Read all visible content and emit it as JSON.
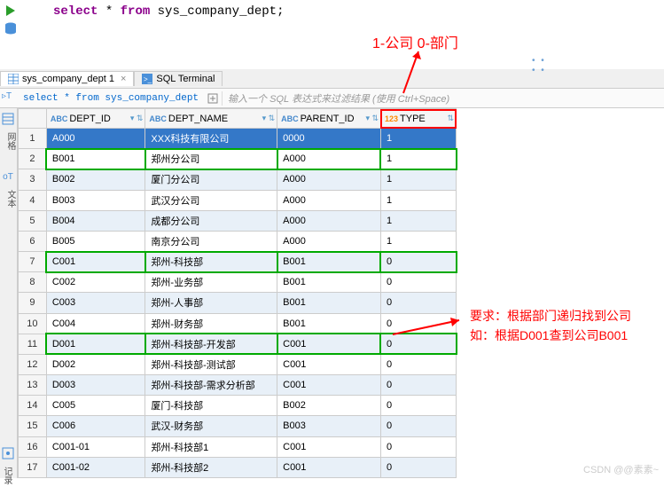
{
  "sql": {
    "keyword_select": "select",
    "star": " * ",
    "keyword_from": "from",
    "table": " sys_company_dept;"
  },
  "annotations": {
    "top": "1-公司   0-部门",
    "right_line1": "要求：根据部门递归找到公司",
    "right_line2": "如：根据D001查到公司B001"
  },
  "tabs": {
    "active": "sys_company_dept 1",
    "second": "SQL Terminal"
  },
  "filter": {
    "indicator": "▹T",
    "query": "select * from sys_company_dept",
    "placeholder": "输入一个 SQL 表达式来过滤结果 (使用 Ctrl+Space)"
  },
  "rail": {
    "grid": "网格",
    "text": "文本",
    "log": "记录"
  },
  "columns": {
    "c1": "DEPT_ID",
    "c2": "DEPT_NAME",
    "c3": "PARENT_ID",
    "c4": "TYPE"
  },
  "rows": [
    {
      "n": "1",
      "id": "A000",
      "name": "XXX科技有限公司",
      "pid": "0000",
      "type": "1"
    },
    {
      "n": "2",
      "id": "B001",
      "name": "郑州分公司",
      "pid": "A000",
      "type": "1"
    },
    {
      "n": "3",
      "id": "B002",
      "name": "厦门分公司",
      "pid": "A000",
      "type": "1"
    },
    {
      "n": "4",
      "id": "B003",
      "name": "武汉分公司",
      "pid": "A000",
      "type": "1"
    },
    {
      "n": "5",
      "id": "B004",
      "name": "成都分公司",
      "pid": "A000",
      "type": "1"
    },
    {
      "n": "6",
      "id": "B005",
      "name": "南京分公司",
      "pid": "A000",
      "type": "1"
    },
    {
      "n": "7",
      "id": "C001",
      "name": "郑州-科技部",
      "pid": "B001",
      "type": "0"
    },
    {
      "n": "8",
      "id": "C002",
      "name": "郑州-业务部",
      "pid": "B001",
      "type": "0"
    },
    {
      "n": "9",
      "id": "C003",
      "name": "郑州-人事部",
      "pid": "B001",
      "type": "0"
    },
    {
      "n": "10",
      "id": "C004",
      "name": "郑州-财务部",
      "pid": "B001",
      "type": "0"
    },
    {
      "n": "11",
      "id": "D001",
      "name": "郑州-科技部-开发部",
      "pid": "C001",
      "type": "0"
    },
    {
      "n": "12",
      "id": "D002",
      "name": "郑州-科技部-测试部",
      "pid": "C001",
      "type": "0"
    },
    {
      "n": "13",
      "id": "D003",
      "name": "郑州-科技部-需求分析部",
      "pid": "C001",
      "type": "0"
    },
    {
      "n": "14",
      "id": "C005",
      "name": "厦门-科技部",
      "pid": "B002",
      "type": "0"
    },
    {
      "n": "15",
      "id": "C006",
      "name": "武汉-财务部",
      "pid": "B003",
      "type": "0"
    },
    {
      "n": "16",
      "id": "C001-01",
      "name": "郑州-科技部1",
      "pid": "C001",
      "type": "0"
    },
    {
      "n": "17",
      "id": "C001-02",
      "name": "郑州-科技部2",
      "pid": "C001",
      "type": "0"
    }
  ],
  "watermark": "CSDN @@素素~"
}
